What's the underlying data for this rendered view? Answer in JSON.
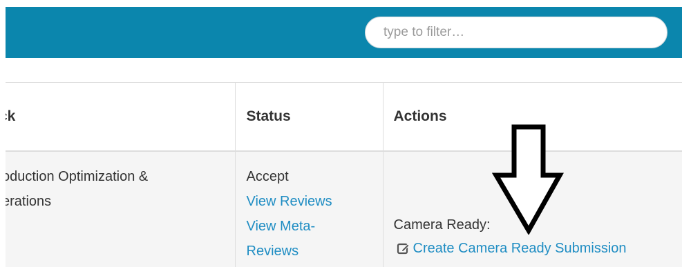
{
  "filter": {
    "placeholder": "type to filter…"
  },
  "table": {
    "columns": {
      "track": "ck",
      "status": "Status",
      "actions": "Actions"
    },
    "row": {
      "track_lines": [
        "oduction Optimization &",
        "erations"
      ],
      "status": "Accept",
      "view_reviews": "View Reviews",
      "view_meta_reviews_lines": [
        "View Meta-",
        "Reviews"
      ],
      "camera_ready_label": "Camera Ready:",
      "create_submission": "Create Camera Ready Submission"
    }
  },
  "icons": {
    "edit": "edit-icon",
    "annotation": "down-arrow-icon"
  },
  "colors": {
    "header": "#0b86ad",
    "link": "#1f8dc3",
    "row_background": "#f5f5f5",
    "border": "#dddddd"
  }
}
